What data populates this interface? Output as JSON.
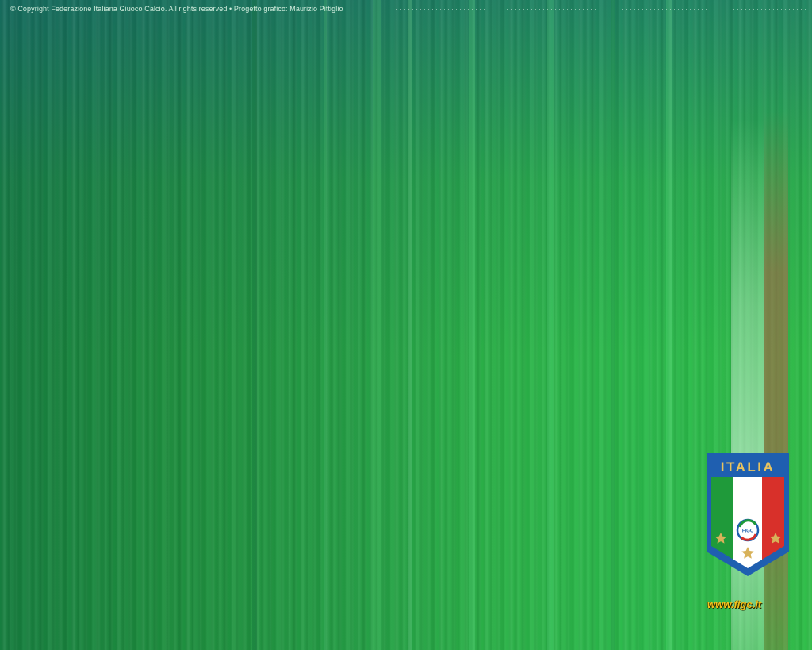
{
  "copyright_text": "© Copyright Federazione Italiana Giuoco Calcio. All rights reserved • Progetto grafico: Maurizio Pittiglio",
  "crest": {
    "title": "ITALIA",
    "emblem_text": "FIGC",
    "colors": {
      "blue": "#1f5fb0",
      "green": "#1f9a3a",
      "white": "#ffffff",
      "red": "#d8302a",
      "gold": "#d8b25a"
    }
  },
  "website_text": "www.figc.it",
  "background_colors": {
    "top_left": "#167f5a",
    "main": "#25a046",
    "right": "#2fbe48"
  }
}
